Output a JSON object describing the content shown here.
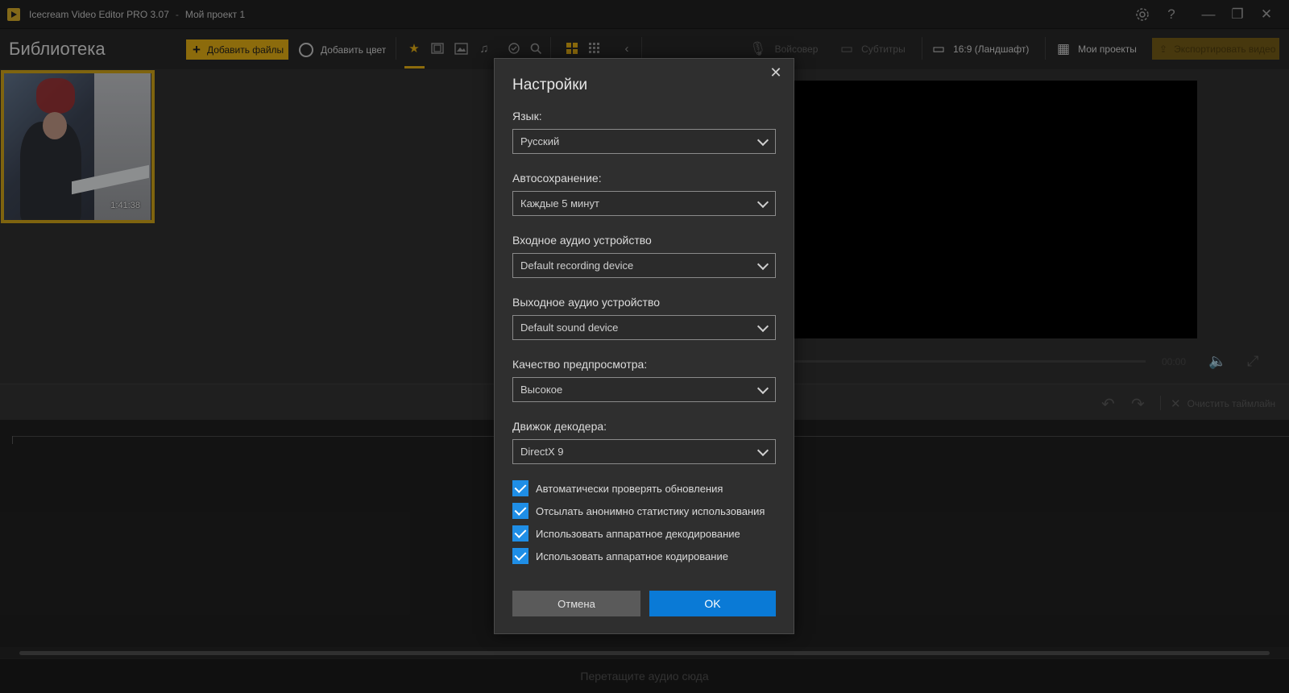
{
  "window": {
    "app_title": "Icecream Video Editor PRO 3.07",
    "separator": "-",
    "project_name": "Мой проект 1",
    "controls": {
      "settings_icon": "gear-icon",
      "help": "?",
      "minimize": "—",
      "restore": "❐",
      "close": "✕"
    }
  },
  "toolbar": {
    "library_title": "Библиотека",
    "add_files_plus": "+",
    "add_files": "Добавить файлы",
    "add_color": "Добавить цвет",
    "voiceover": "Войсовер",
    "subtitles": "Субтитры",
    "aspect_ratio": "16:9 (Ландшафт)",
    "my_projects": "Мои проекты",
    "export": "Экспортировать видео"
  },
  "library": {
    "items": [
      {
        "duration": "1:41:38"
      }
    ]
  },
  "player": {
    "timecode": "00:00"
  },
  "timeline": {
    "clear": "Очистить таймлайн",
    "audio_drop": "Перетащите аудио сюда"
  },
  "dialog": {
    "title": "Настройки",
    "close": "✕",
    "fields": [
      {
        "label": "Язык:",
        "value": "Русский"
      },
      {
        "label": "Автосохранение:",
        "value": "Каждые 5 минут"
      },
      {
        "label": "Входное аудио устройство",
        "value": "Default recording device"
      },
      {
        "label": "Выходное аудио устройство",
        "value": "Default sound device"
      },
      {
        "label": "Качество предпросмотра:",
        "value": "Высокое"
      },
      {
        "label": "Движок декодера:",
        "value": "DirectX 9"
      }
    ],
    "checkboxes": [
      {
        "label": "Автоматически проверять обновления",
        "checked": true
      },
      {
        "label": "Отсылать анонимно статистику использования",
        "checked": true
      },
      {
        "label": "Использовать аппаратное декодирование",
        "checked": true
      },
      {
        "label": "Использовать аппаратное кодирование",
        "checked": true
      }
    ],
    "cancel": "Отмена",
    "ok": "OK"
  },
  "colors": {
    "accent": "#d8a513",
    "primary_button": "#0a7ad6",
    "checkbox": "#1f8ee6"
  }
}
